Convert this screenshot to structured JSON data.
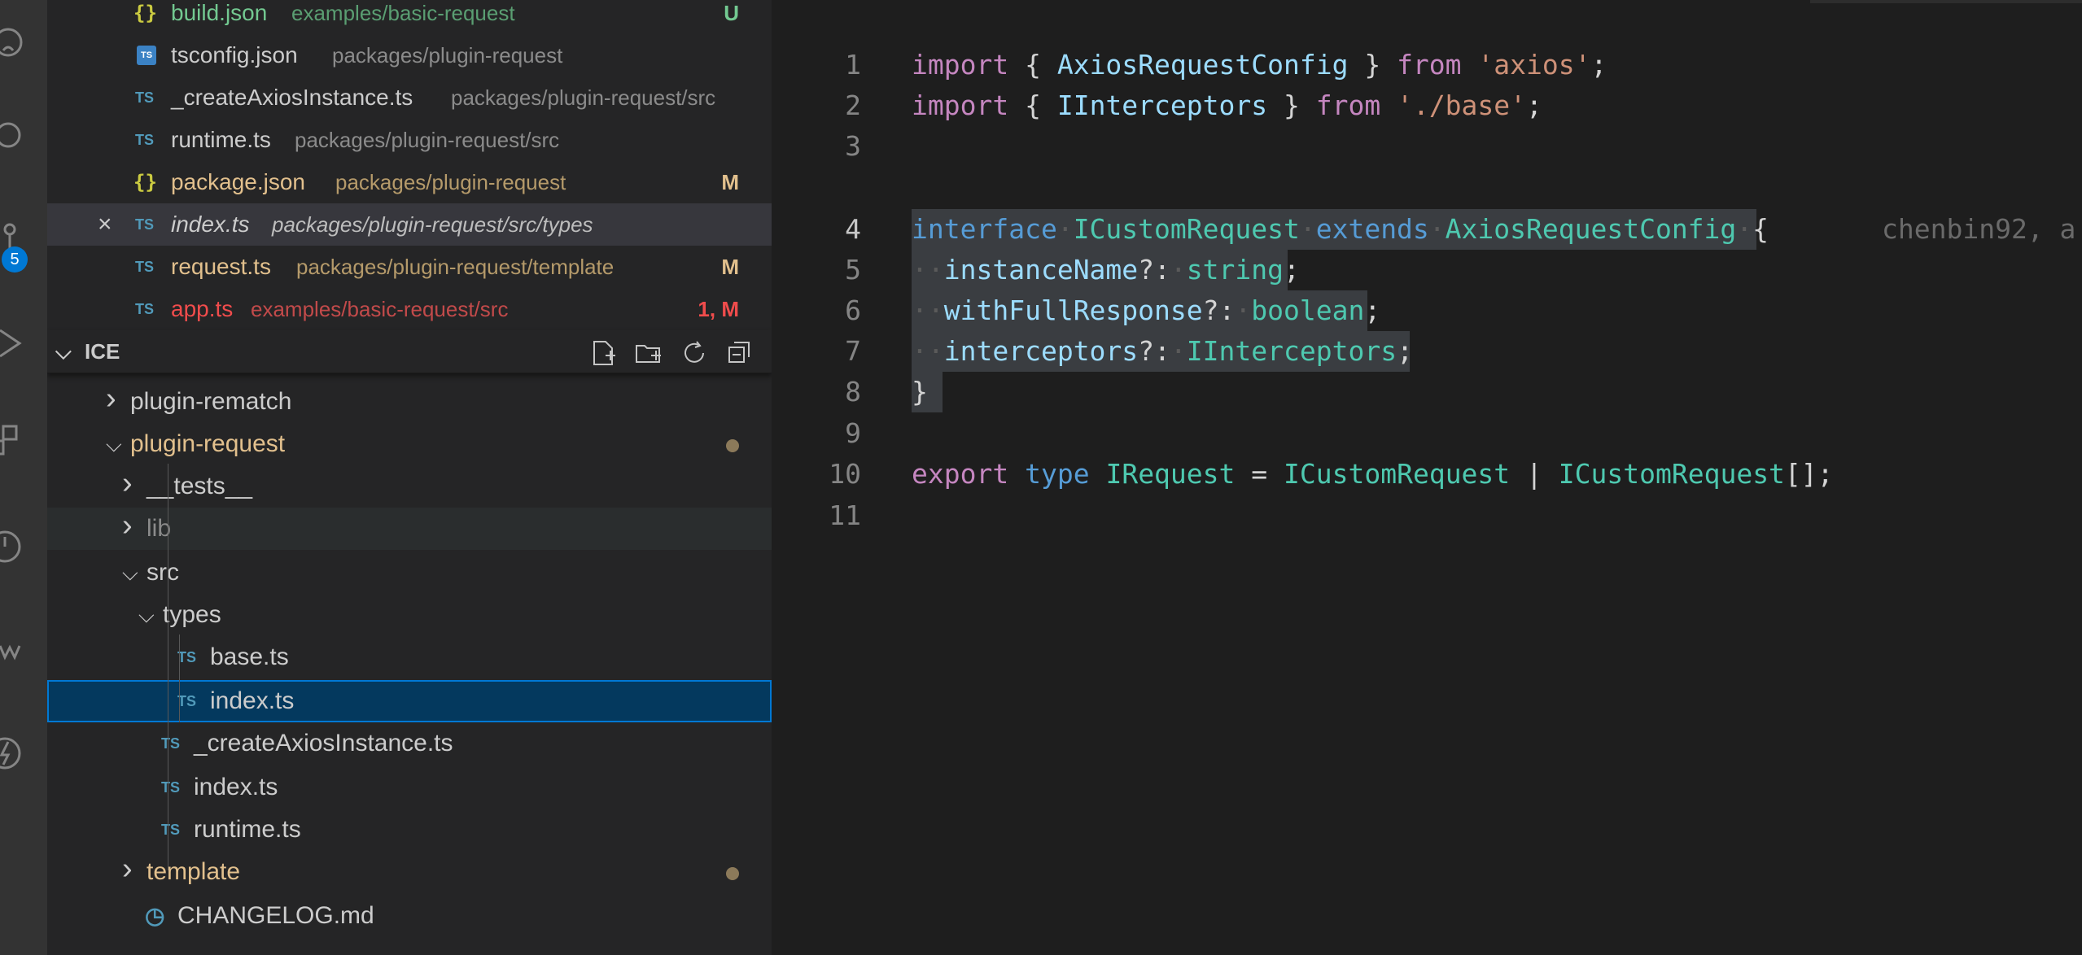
{
  "activity_bar": {
    "icons": [
      "github-icon",
      "source-control-icon",
      "branch-icon",
      "run-debug-icon",
      "extensions-icon",
      "timeline-icon",
      "lint-icon",
      "thunder-icon"
    ],
    "badge": "5"
  },
  "open_editors": [
    {
      "icon": "json",
      "name": "build.json",
      "path": "examples/basic-request",
      "status": "U",
      "color": "green"
    },
    {
      "icon": "tsconfig",
      "icon_text": "TS",
      "name": "tsconfig.json",
      "path": "packages/plugin-request",
      "status": "",
      "color": "white"
    },
    {
      "icon": "ts",
      "icon_text": "TS",
      "name": "_createAxiosInstance.ts",
      "path": "packages/plugin-request/src",
      "status": "",
      "color": "white"
    },
    {
      "icon": "ts",
      "icon_text": "TS",
      "name": "runtime.ts",
      "path": "packages/plugin-request/src",
      "status": "",
      "color": "white"
    },
    {
      "icon": "json",
      "name": "package.json",
      "path": "packages/plugin-request",
      "status": "M",
      "color": "yellow"
    },
    {
      "icon": "ts",
      "icon_text": "TS",
      "name": "index.ts",
      "path": "packages/plugin-request/src/types",
      "status": "",
      "color": "white",
      "active": true
    },
    {
      "icon": "ts",
      "icon_text": "TS",
      "name": "request.ts",
      "path": "packages/plugin-request/template",
      "status": "M",
      "color": "yellow"
    },
    {
      "icon": "ts",
      "icon_text": "TS",
      "name": "app.ts",
      "path": "examples/basic-request/src",
      "status": "1, M",
      "color": "red"
    }
  ],
  "json_icon_glyph": "{}",
  "close_glyph": "×",
  "explorer": {
    "title": "ICE",
    "chevron_down": "⌵",
    "chevron_right": "›",
    "tools": [
      "new-file-icon",
      "new-folder-icon",
      "refresh-icon",
      "collapse-all-icon"
    ],
    "items": [
      {
        "kind": "folder",
        "name": "plugin-rematch",
        "expanded": false,
        "color": "white"
      },
      {
        "kind": "folder",
        "name": "plugin-request",
        "expanded": true,
        "color": "yellow",
        "dot": true
      },
      {
        "kind": "folder",
        "name": "__tests__",
        "expanded": false,
        "color": "white"
      },
      {
        "kind": "folder",
        "name": "lib",
        "expanded": false,
        "color": "dim",
        "hover": true
      },
      {
        "kind": "folder",
        "name": "src",
        "expanded": true,
        "color": "white"
      },
      {
        "kind": "folder",
        "name": "types",
        "expanded": true,
        "color": "white"
      },
      {
        "kind": "file",
        "icon_text": "TS",
        "name": "base.ts",
        "color": "white"
      },
      {
        "kind": "file",
        "icon_text": "TS",
        "name": "index.ts",
        "color": "white",
        "selected": true
      },
      {
        "kind": "file",
        "icon_text": "TS",
        "name": "_createAxiosInstance.ts",
        "color": "white"
      },
      {
        "kind": "file",
        "icon_text": "TS",
        "name": "index.ts",
        "color": "white"
      },
      {
        "kind": "file",
        "icon_text": "TS",
        "name": "runtime.ts",
        "color": "white"
      },
      {
        "kind": "folder",
        "name": "template",
        "expanded": false,
        "color": "yellow",
        "dot": true
      },
      {
        "kind": "file",
        "icon": "clock",
        "icon_text": "◷",
        "name": "CHANGELOG.md",
        "color": "white"
      }
    ]
  },
  "editor": {
    "lines": [
      {
        "n": "1",
        "tokens": [
          [
            "kw",
            "import"
          ],
          [
            "punc",
            " { "
          ],
          [
            "prop",
            "AxiosRequestConfig"
          ],
          [
            "punc",
            " } "
          ],
          [
            "kw",
            "from"
          ],
          [
            "punc",
            " "
          ],
          [
            "str",
            "'axios'"
          ],
          [
            "punc",
            ";"
          ]
        ]
      },
      {
        "n": "2",
        "tokens": [
          [
            "kw",
            "import"
          ],
          [
            "punc",
            " { "
          ],
          [
            "prop",
            "IInterceptors"
          ],
          [
            "punc",
            " } "
          ],
          [
            "kw",
            "from"
          ],
          [
            "punc",
            " "
          ],
          [
            "str",
            "'./base'"
          ],
          [
            "punc",
            ";"
          ]
        ]
      },
      {
        "n": "3",
        "tokens": []
      },
      {
        "n": "4",
        "active": true,
        "tokens": [
          [
            "kw2",
            "interface"
          ],
          [
            "ws",
            "·"
          ],
          [
            "type",
            "ICustomRequest"
          ],
          [
            "ws",
            "·"
          ],
          [
            "kw2",
            "extends"
          ],
          [
            "ws",
            "·"
          ],
          [
            "type",
            "AxiosRequestConfig"
          ],
          [
            "ws",
            "·"
          ],
          [
            "punc",
            "{"
          ]
        ],
        "blame": "chenbin92, a"
      },
      {
        "n": "5",
        "tokens": [
          [
            "ws",
            "··"
          ],
          [
            "prop",
            "instanceName"
          ],
          [
            "punc",
            "?:"
          ],
          [
            "ws",
            "·"
          ],
          [
            "type",
            "string"
          ],
          [
            "punc",
            ";"
          ]
        ]
      },
      {
        "n": "6",
        "tokens": [
          [
            "ws",
            "··"
          ],
          [
            "prop",
            "withFullResponse"
          ],
          [
            "punc",
            "?:"
          ],
          [
            "ws",
            "·"
          ],
          [
            "type",
            "boolean"
          ],
          [
            "punc",
            ";"
          ]
        ]
      },
      {
        "n": "7",
        "tokens": [
          [
            "ws",
            "··"
          ],
          [
            "prop",
            "interceptors"
          ],
          [
            "punc",
            "?:"
          ],
          [
            "ws",
            "·"
          ],
          [
            "type",
            "IInterceptors"
          ],
          [
            "punc",
            ";"
          ]
        ]
      },
      {
        "n": "8",
        "tokens": [
          [
            "punc",
            "}"
          ]
        ]
      },
      {
        "n": "9",
        "tokens": []
      },
      {
        "n": "10",
        "tokens": [
          [
            "kw",
            "export"
          ],
          [
            "punc",
            " "
          ],
          [
            "kw2",
            "type"
          ],
          [
            "punc",
            " "
          ],
          [
            "type",
            "IRequest"
          ],
          [
            "punc",
            " = "
          ],
          [
            "type",
            "ICustomRequest"
          ],
          [
            "punc",
            " | "
          ],
          [
            "type",
            "ICustomRequest"
          ],
          [
            "punc",
            "[];"
          ]
        ]
      },
      {
        "n": "11",
        "tokens": []
      }
    ]
  },
  "colors": {
    "accent": "#0078d4",
    "selection": "#04395e",
    "modified": "#e2c08d",
    "untracked": "#73c991",
    "error": "#f14c4c"
  }
}
